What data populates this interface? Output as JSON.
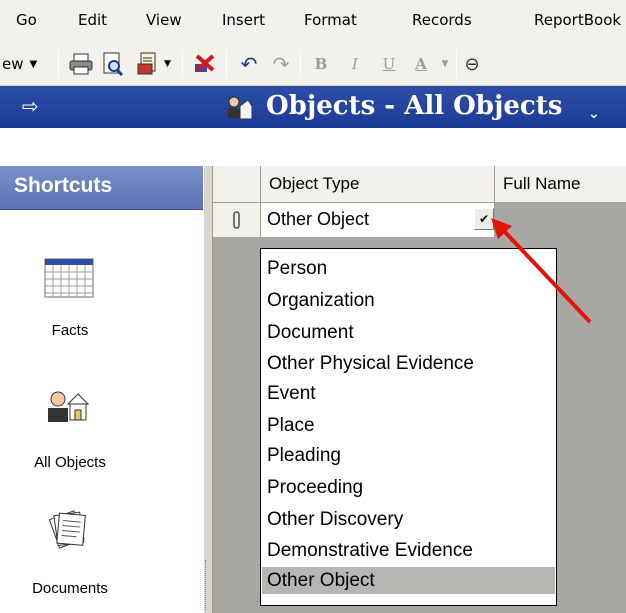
{
  "menubar": {
    "items": [
      {
        "label": "Go"
      },
      {
        "label": "Edit"
      },
      {
        "label": "View"
      },
      {
        "label": "Insert"
      },
      {
        "label": "Format"
      },
      {
        "label": "Records"
      },
      {
        "label": "ReportBook"
      }
    ]
  },
  "toolbar": {
    "view_label": "ew"
  },
  "window": {
    "title": "Objects - All Objects"
  },
  "shortcuts": {
    "header": "Shortcuts",
    "items": [
      {
        "label": "Facts",
        "icon": "calendar-grid-icon"
      },
      {
        "label": "All Objects",
        "icon": "person-house-icon"
      },
      {
        "label": "Documents",
        "icon": "documents-stack-icon"
      }
    ]
  },
  "grid": {
    "columns": [
      "Object Type",
      "Full Name"
    ],
    "row": {
      "object_type": "Other Object"
    }
  },
  "dropdown": {
    "options": [
      "Person",
      "Organization",
      "Document",
      "Other Physical Evidence",
      "Event",
      "Place",
      "Pleading",
      "Proceeding",
      "Other Discovery",
      "Demonstrative Evidence",
      "Other Object"
    ],
    "selected": "Other Object"
  },
  "colors": {
    "title_bar": "#1f3f9a",
    "shortcuts_header": "#6b80bf",
    "annotation_arrow": "#e3120b"
  }
}
